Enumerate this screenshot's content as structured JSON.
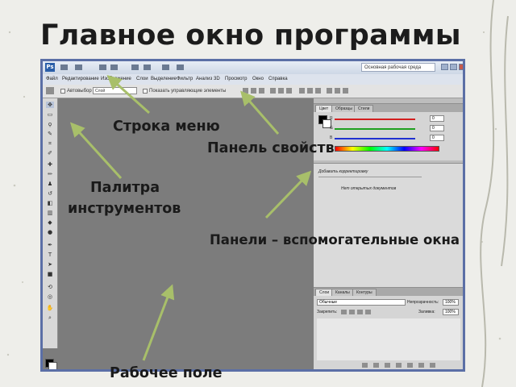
{
  "slide": {
    "title": "Главное окно программы"
  },
  "app": {
    "workspace_select": "Основная рабочая среда",
    "menu": [
      "Файл",
      "Редактирование",
      "Изображение",
      "Слои",
      "Выделение",
      "Фильтр",
      "Анализ",
      "3D",
      "Просмотр",
      "Окно",
      "Справка"
    ],
    "options": {
      "antialias_label": "Автовыбор",
      "layer_field": "Слой",
      "transform_label": "Показать управляющие элементы"
    },
    "color_panel": {
      "tabs": [
        "Цвет",
        "Образцы",
        "Стили"
      ],
      "channels": [
        {
          "name": "R",
          "value": "0",
          "color": "#d22020"
        },
        {
          "name": "G",
          "value": "0",
          "color": "#20a020"
        },
        {
          "name": "B",
          "value": "0",
          "color": "#2030d0"
        }
      ]
    },
    "adjust_panel": {
      "title": "Добавить корректировку",
      "message": "Нет открытых документов"
    },
    "layers_panel": {
      "tabs": [
        "Слои",
        "Каналы",
        "Контуры"
      ],
      "blend_mode": "Обычные",
      "opacity_label": "Непрозрачность:",
      "opacity_value": "100%",
      "lock_label": "Закрепить:",
      "fill_label": "Заливка:",
      "fill_value": "100%"
    }
  },
  "annotations": {
    "menu_bar": "Строка меню",
    "options_bar": "Панель свойств",
    "toolbox_line1": "Палитра",
    "toolbox_line2": "инструментов",
    "panels": "Панели – вспомогательные окна",
    "workspace": "Рабочее поле"
  },
  "colors": {
    "arrow": "#a8bf6a",
    "frame": "#5b6fa6",
    "work_area": "#7c7c7c"
  }
}
